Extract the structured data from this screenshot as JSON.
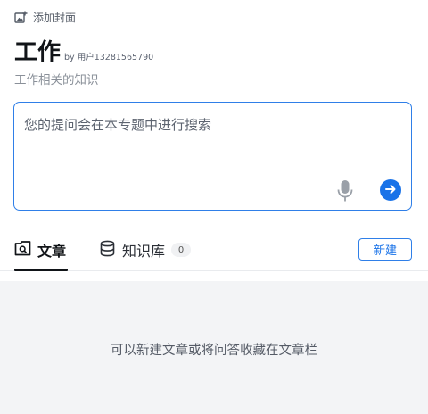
{
  "header": {
    "add_cover_label": "添加封面",
    "title": "工作",
    "owner": "by 用户13281565790",
    "description": "工作相关的知识"
  },
  "ask": {
    "placeholder": "您的提问会在本专题中进行搜索",
    "icons": {
      "voice": "microphone-icon",
      "send": "arrow-right-circle-icon"
    },
    "accent": "#1a73e8"
  },
  "tabs": [
    {
      "label": "文章",
      "icon": "article-box-icon",
      "active": true
    },
    {
      "label": "知识库",
      "icon": "database-icon",
      "count": "0",
      "active": false
    }
  ],
  "actions": {
    "new_label": "新建"
  },
  "empty_state": {
    "message": "可以新建文章或将问答收藏在文章栏"
  }
}
